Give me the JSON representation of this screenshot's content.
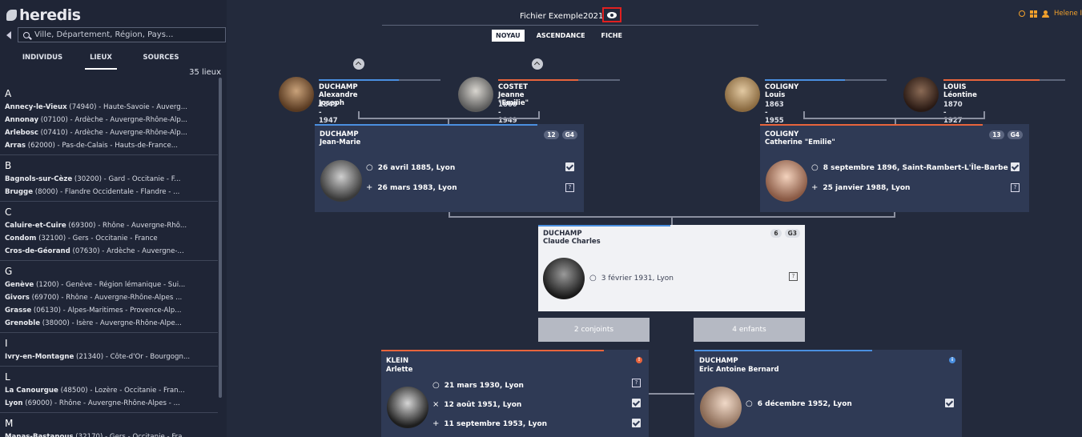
{
  "app": {
    "logo": "heredis",
    "file_title": "Fichier Exemple2021",
    "user": "Helene I"
  },
  "search": {
    "placeholder": "Ville, Département, Région, Pays..."
  },
  "sidebar": {
    "tabs": [
      "INDIVIDUS",
      "LIEUX",
      "SOURCES"
    ],
    "active_tab": "LIEUX",
    "count": "35 lieux",
    "groups": [
      {
        "letter": "A",
        "places": [
          [
            "Annecy-le-Vieux",
            " (74940) - Haute-Savoie - Auverg..."
          ],
          [
            "Annonay",
            " (07100) - Ardèche - Auvergne-Rhône-Alp..."
          ],
          [
            "Arlebosc",
            " (07410) - Ardèche - Auvergne-Rhône-Alp..."
          ],
          [
            "Arras",
            " (62000) - Pas-de-Calais - Hauts-de-France..."
          ]
        ]
      },
      {
        "letter": "B",
        "places": [
          [
            "Bagnols-sur-Cèze",
            " (30200) - Gard - Occitanie - F..."
          ],
          [
            "Brugge",
            " (8000) - Flandre Occidentale - Flandre - ..."
          ]
        ]
      },
      {
        "letter": "C",
        "places": [
          [
            "Caluire-et-Cuire",
            " (69300) - Rhône - Auvergne-Rhô..."
          ],
          [
            "Condom",
            " (32100) - Gers - Occitanie - France"
          ],
          [
            "Cros-de-Géorand",
            " (07630) - Ardèche - Auvergne-..."
          ]
        ]
      },
      {
        "letter": "G",
        "places": [
          [
            "Genève",
            " (1200) - Genève - Région lémanique - Sui..."
          ],
          [
            "Givors",
            " (69700) - Rhône - Auvergne-Rhône-Alpes ..."
          ],
          [
            "Grasse",
            " (06130) - Alpes-Maritimes - Provence-Alp..."
          ],
          [
            "Grenoble",
            " (38000) - Isère - Auvergne-Rhône-Alpe..."
          ]
        ]
      },
      {
        "letter": "I",
        "places": [
          [
            "Ivry-en-Montagne",
            " (21340) - Côte-d'Or - Bourgogn..."
          ]
        ]
      },
      {
        "letter": "L",
        "places": [
          [
            "La Canourgue",
            " (48500) - Lozère - Occitanie - Fran..."
          ],
          [
            "Lyon",
            " (69000) - Rhône - Auvergne-Rhône-Alpes - ..."
          ]
        ]
      },
      {
        "letter": "M",
        "places": [
          [
            "Manas-Bastanous",
            " (32170) - Gers - Occitanie - Fra..."
          ]
        ]
      }
    ]
  },
  "view_tabs": [
    "NOYAU",
    "ASCENDANCE",
    "FICHE"
  ],
  "active_view": "NOYAU",
  "grandparents": [
    {
      "surname": "DUCHAMP",
      "given": "Alexandre Joseph",
      "dates": "1849 - 1947",
      "sex": "m"
    },
    {
      "surname": "COSTET",
      "given": "Jeanne \"Emilie\"",
      "dates": "1860 - 1949",
      "sex": "f"
    },
    {
      "surname": "COLIGNY",
      "given": "Louis",
      "dates": "1863 - 1955",
      "sex": "m"
    },
    {
      "surname": "LOUIS",
      "given": "Léontine",
      "dates": "1870 - 1927",
      "sex": "f"
    }
  ],
  "father": {
    "surname": "DUCHAMP",
    "given": "Jean-Marie",
    "badge_count": "12",
    "badge_gen": "G4",
    "birth": "26 avril 1885, Lyon",
    "death": "26 mars 1983, Lyon"
  },
  "mother": {
    "surname": "COLIGNY",
    "given": "Catherine \"Emilie\"",
    "badge_count": "13",
    "badge_gen": "G4",
    "birth": "8 septembre 1896, Saint-Rambert-L'Île-Barbe",
    "death": "25 janvier 1988, Lyon"
  },
  "subject": {
    "surname": "DUCHAMP",
    "given": "Claude Charles",
    "badge_count": "6",
    "badge_gen": "G3",
    "birth": "3 février 1931, Lyon"
  },
  "pills": {
    "spouses": "2 conjoints",
    "children": "4 enfants"
  },
  "spouse": {
    "surname": "KLEIN",
    "given": "Arlette",
    "birth": "21 mars 1930, Lyon",
    "marriage": "12 août 1951, Lyon",
    "death": "11 septembre 1953, Lyon"
  },
  "child": {
    "surname": "DUCHAMP",
    "given": "Eric Antoine Bernard",
    "birth": "6 décembre 1952, Lyon"
  },
  "colors": {
    "male": "#4a8fe0",
    "female": "#e8643c",
    "accent": "#f0a02c",
    "alert_orange": "#e8643c",
    "alert_blue": "#4a8fe0"
  }
}
